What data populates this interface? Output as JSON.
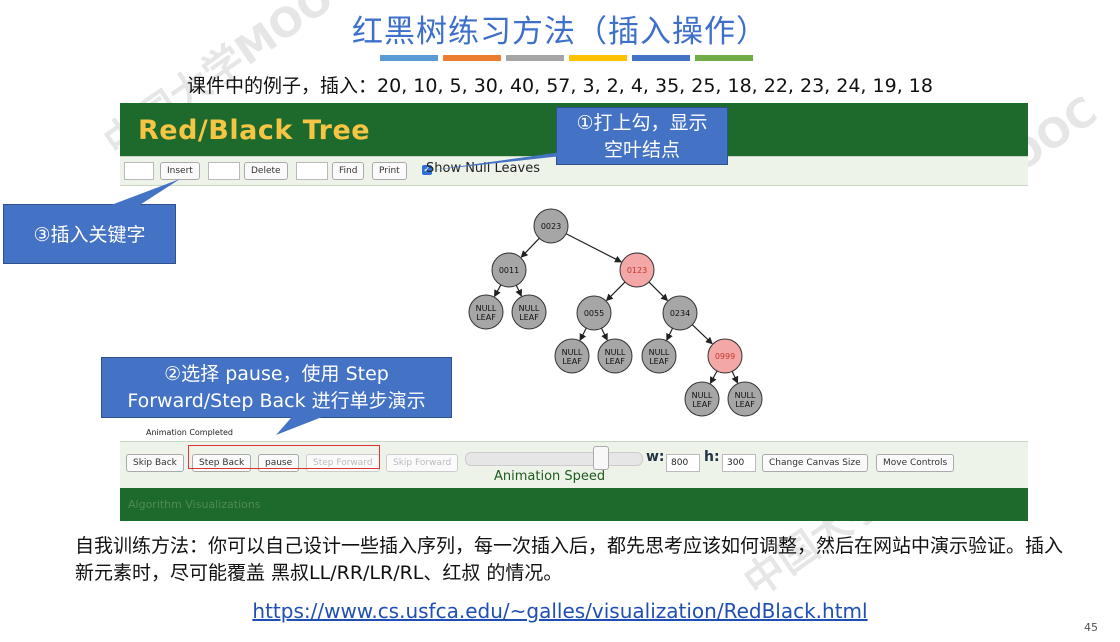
{
  "slide": {
    "title": "红黑树练习方法（插入操作）",
    "example": "课件中的例子，插入：20, 10, 5, 30, 40, 57, 3, 2, 4, 35, 25, 18, 22, 23, 24, 19, 18",
    "description": "自我训练方法：你可以自己设计一些插入序列，每一次插入后，都先思考应该如何调整，然后在网站中演示验证。插入新元素时，尽可能覆盖 黑叔LL/RR/LR/RL、红叔 的情况。",
    "link": "https://www.cs.usfca.edu/~galles/visualization/RedBlack.html",
    "page_number": "45",
    "color_bars": [
      "#5b9bd5",
      "#ed7d31",
      "#a5a5a5",
      "#ffc000",
      "#4472c4",
      "#70ad47"
    ],
    "title_color": "#3d6fcb"
  },
  "app": {
    "title": "Red/Black Tree",
    "header_color": "#1e6a2c",
    "title_color": "#f6c544",
    "toolbar": {
      "insert": "Insert",
      "delete": "Delete",
      "find": "Find",
      "print": "Print",
      "show_null_leaves": "Show Null Leaves",
      "show_null_leaves_checked": true
    },
    "status": "Animation Completed",
    "controls": {
      "skip_back": "Skip Back",
      "step_back": "Step Back",
      "pause": "pause",
      "step_forward": "Step Forward",
      "skip_forward": "Skip Forward",
      "animation_speed": "Animation Speed",
      "w_label": "w:",
      "w_value": "800",
      "h_label": "h:",
      "h_value": "300",
      "change_canvas": "Change Canvas Size",
      "move_controls": "Move Controls"
    },
    "footer": "Algorithm Visualizations",
    "tree": {
      "nodes": [
        {
          "id": "n23",
          "label": "0023",
          "color": "black"
        },
        {
          "id": "n11",
          "label": "0011",
          "color": "black"
        },
        {
          "id": "n123",
          "label": "0123",
          "color": "red"
        },
        {
          "id": "l1",
          "label": "NULL LEAF",
          "color": "black"
        },
        {
          "id": "l2",
          "label": "NULL LEAF",
          "color": "black"
        },
        {
          "id": "n55",
          "label": "0055",
          "color": "black"
        },
        {
          "id": "n234",
          "label": "0234",
          "color": "black"
        },
        {
          "id": "l3",
          "label": "NULL LEAF",
          "color": "black"
        },
        {
          "id": "l4",
          "label": "NULL LEAF",
          "color": "black"
        },
        {
          "id": "l5",
          "label": "NULL LEAF",
          "color": "black"
        },
        {
          "id": "n999",
          "label": "0999",
          "color": "red"
        },
        {
          "id": "l6",
          "label": "NULL LEAF",
          "color": "black"
        },
        {
          "id": "l7",
          "label": "NULL LEAF",
          "color": "black"
        }
      ],
      "edges": [
        [
          "n23",
          "n11"
        ],
        [
          "n23",
          "n123"
        ],
        [
          "n11",
          "l1"
        ],
        [
          "n11",
          "l2"
        ],
        [
          "n123",
          "n55"
        ],
        [
          "n123",
          "n234"
        ],
        [
          "n55",
          "l3"
        ],
        [
          "n55",
          "l4"
        ],
        [
          "n234",
          "l5"
        ],
        [
          "n234",
          "n999"
        ],
        [
          "n999",
          "l6"
        ],
        [
          "n999",
          "l7"
        ]
      ]
    }
  },
  "callouts": {
    "c1": "①打上勾，显示空叶结点",
    "c2": "②选择 pause，使用 Step Forward/Step Back 进行单步演示",
    "c3": "③插入关键字",
    "color": "#4472c4"
  }
}
